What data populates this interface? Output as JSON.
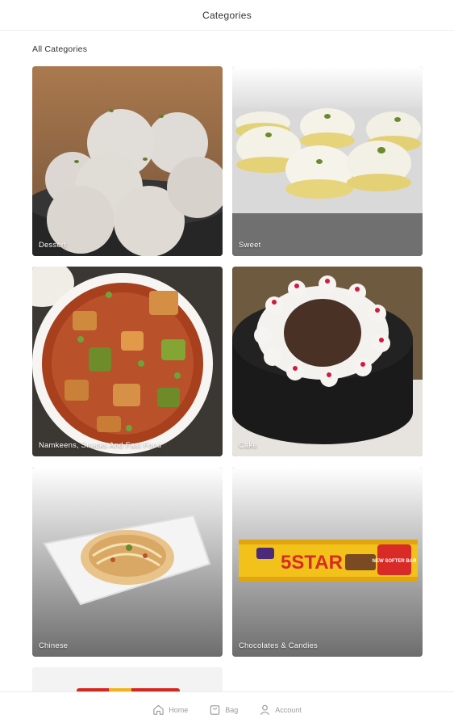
{
  "header": {
    "title": "Categories"
  },
  "section": {
    "label": "All Categories"
  },
  "categories": [
    {
      "name": "Dessert"
    },
    {
      "name": "Sweet"
    },
    {
      "name": "Namkeens, Snacks And Fast Food"
    },
    {
      "name": "Cake"
    },
    {
      "name": "Chinese"
    },
    {
      "name": "Chocolates & Candies"
    }
  ],
  "bottom_nav": {
    "home": "Home",
    "bag": "Bag",
    "account": "Account"
  },
  "brand_text": {
    "product_logo": "5STAR",
    "badge": "NEW SOFTER BAR"
  }
}
